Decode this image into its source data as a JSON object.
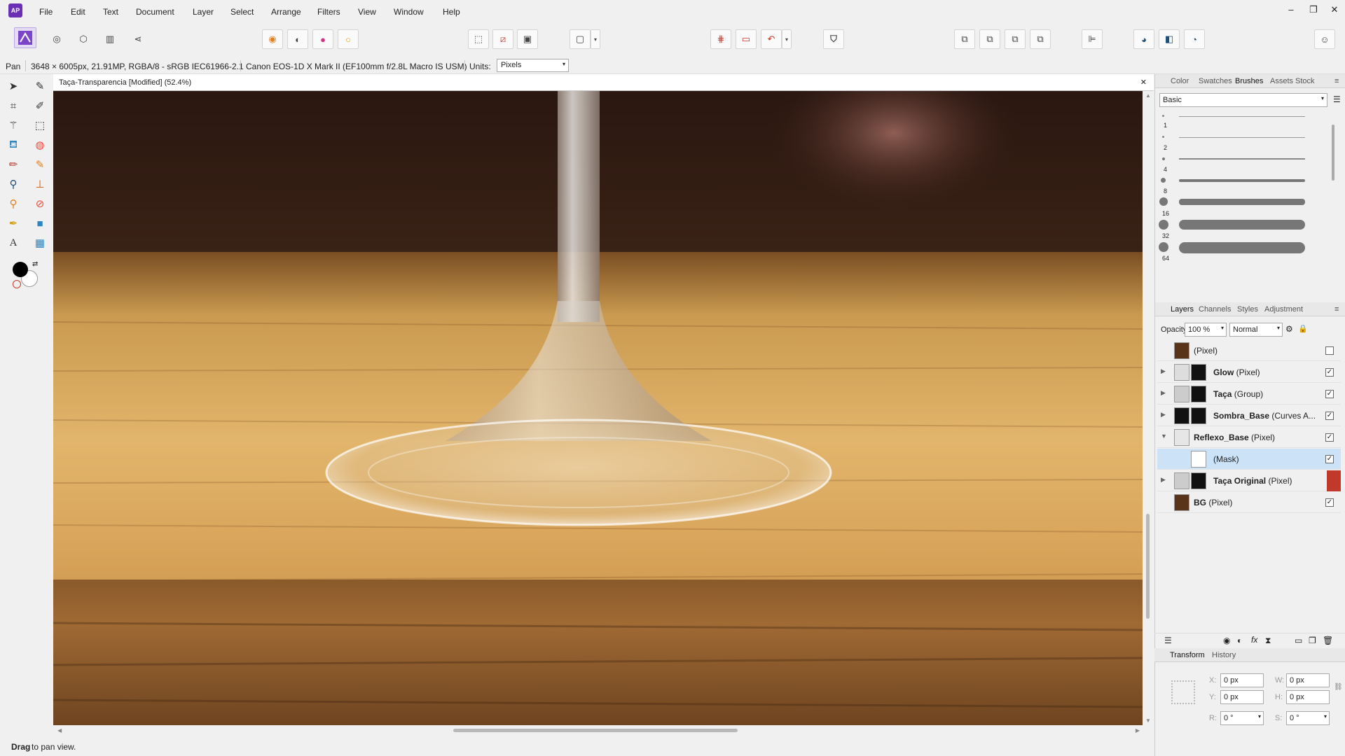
{
  "app": {
    "logo_text": "AP"
  },
  "menu": [
    "File",
    "Edit",
    "Text",
    "Document",
    "Layer",
    "Select",
    "Arrange",
    "Filters",
    "View",
    "Window",
    "Help"
  ],
  "window_controls": {
    "minimize": "–",
    "restore": "❐",
    "close": "✕"
  },
  "context_bar": {
    "tool": "Pan",
    "doc_info": "3648 × 6005px, 21.91MP, RGBA/8 - sRGB IEC61966-2.1",
    "camera": "Canon EOS-1D X Mark II (EF100mm f/2.8L Macro IS USM)",
    "units_label": "Units:",
    "units_value": "Pixels"
  },
  "document": {
    "tab_title": "Taça-Transparencia [Modified] (52.4%)",
    "close": "✕"
  },
  "status": {
    "bold": "Drag",
    "text": " to pan view."
  },
  "top_panel": {
    "tabs": [
      "Color",
      "Swatches",
      "Brushes",
      "Assets",
      "Stock"
    ],
    "active_tab": "Brushes",
    "category": "Basic",
    "brush_sizes": [
      "1",
      "2",
      "4",
      "8",
      "16",
      "32",
      "64"
    ]
  },
  "layers_panel": {
    "tabs": [
      "Layers",
      "Channels",
      "Styles",
      "Adjustment"
    ],
    "active_tab": "Layers",
    "opacity_label": "Opacity:",
    "opacity_value": "100 %",
    "blend_mode": "Normal",
    "layers": [
      {
        "bold": "",
        "type": "(Pixel)",
        "checked": false,
        "expander": "",
        "selected": false,
        "indent": false
      },
      {
        "bold": "Glow",
        "type": " (Pixel)",
        "checked": true,
        "expander": "▶",
        "selected": false,
        "indent": false
      },
      {
        "bold": "Taça",
        "type": " (Group)",
        "checked": true,
        "expander": "▶",
        "selected": false,
        "indent": false
      },
      {
        "bold": "Sombra_Base",
        "type": " (Curves A...",
        "checked": true,
        "expander": "▶",
        "selected": false,
        "indent": false
      },
      {
        "bold": "Reflexo_Base",
        "type": " (Pixel)",
        "checked": true,
        "expander": "▼",
        "selected": false,
        "indent": false
      },
      {
        "bold": "",
        "type": "(Mask)",
        "checked": true,
        "expander": "",
        "selected": true,
        "indent": true
      },
      {
        "bold": "Taça Original",
        "type": " (Pixel)",
        "checked": false,
        "expander": "▶",
        "selected": false,
        "indent": false,
        "red_flag": true
      },
      {
        "bold": "BG",
        "type": " (Pixel)",
        "checked": true,
        "expander": "",
        "selected": false,
        "indent": false
      }
    ]
  },
  "transform_panel": {
    "tabs": [
      "Transform",
      "History"
    ],
    "active_tab": "Transform",
    "x_label": "X:",
    "x_value": "0 px",
    "y_label": "Y:",
    "y_value": "0 px",
    "w_label": "W:",
    "w_value": "0 px",
    "h_label": "H:",
    "h_value": "0 px",
    "r_label": "R:",
    "r_value": "0 °",
    "s_label": "S:",
    "s_value": "0 °"
  },
  "colors": {
    "accent": "#6a2fb5",
    "selection": "#cce3f7",
    "flag_red": "#c0392b"
  }
}
